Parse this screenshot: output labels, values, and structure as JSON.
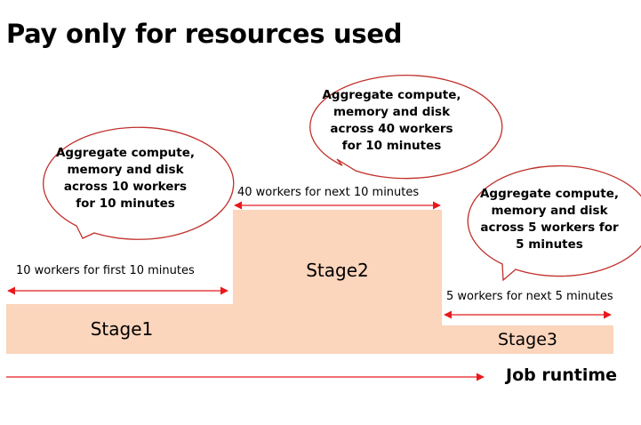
{
  "title": "Pay only for resources used",
  "stages": [
    {
      "name": "Stage1",
      "workers": 10,
      "duration_minutes": 10,
      "range_label": "10 workers for first 10 minutes",
      "callout": "Aggregate compute,\nmemory and disk\nacross 10 workers\nfor 10 minutes"
    },
    {
      "name": "Stage2",
      "workers": 40,
      "duration_minutes": 10,
      "range_label": "40 workers for next 10 minutes",
      "callout": "Aggregate compute,\nmemory and disk\nacross 40 workers\nfor 10 minutes"
    },
    {
      "name": "Stage3",
      "workers": 5,
      "duration_minutes": 5,
      "range_label": "5 workers for next 5 minutes",
      "callout": "Aggregate compute,\nmemory and disk\nacross 5 workers for\n5 minutes"
    }
  ],
  "axis_label": "Job runtime",
  "colors": {
    "block_fill": "#fbd5bc",
    "arrow": "#e8191c",
    "bubble_stroke": "#c0302b"
  }
}
